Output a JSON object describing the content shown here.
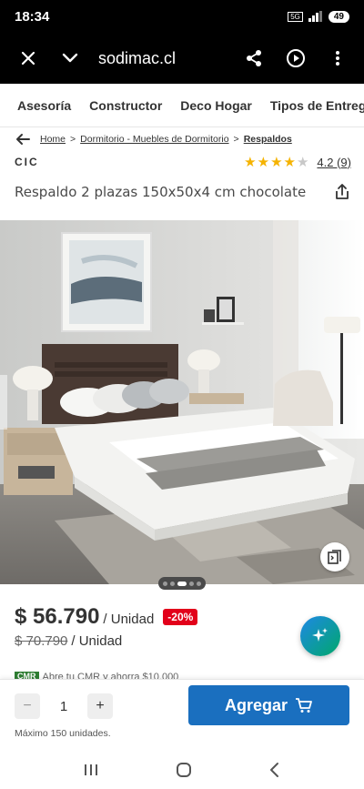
{
  "status_bar": {
    "time": "18:34",
    "network": "5G",
    "battery": "49"
  },
  "browser": {
    "url": "sodimac.cl"
  },
  "nav_tabs": [
    "Asesoría",
    "Constructor",
    "Deco Hogar",
    "Tipos de Entrega"
  ],
  "breadcrumb": {
    "items": [
      "Home",
      "Dormitorio - Muebles de Dormitorio",
      "Respaldos"
    ],
    "separator": ">"
  },
  "product": {
    "brand": "CIC",
    "rating": 4.2,
    "rating_text": "4.2 (9)",
    "title": "Respaldo 2 plazas 150x50x4 cm chocolate"
  },
  "gallery": {
    "image_count": 5,
    "active_index": 2
  },
  "pricing": {
    "price": "$ 56.790",
    "unit": "/ Unidad",
    "discount": "-20%",
    "old_price": "$ 70.790",
    "old_unit": "/ Unidad"
  },
  "cmr": {
    "badge": "CMR",
    "text": "Abre tu CMR y ahorra $10.000"
  },
  "purchase": {
    "minus": "−",
    "quantity": "1",
    "plus": "+",
    "add_label": "Agregar",
    "max_note": "Máximo 150 unidades."
  },
  "colors": {
    "primary_blue": "#1a6fbf",
    "discount_red": "#e2001a",
    "star": "#f5b301",
    "cmr_green": "#2e7d32"
  },
  "icons": {
    "browser": [
      "close-icon",
      "chevron-down-icon",
      "share-icon",
      "play-circle-icon",
      "more-vert-icon"
    ],
    "product": [
      "back-arrow-icon",
      "share-upload-icon",
      "save-collection-icon",
      "sparkle-icon",
      "cart-icon"
    ],
    "system_nav": [
      "recents-icon",
      "home-icon",
      "back-icon"
    ]
  }
}
